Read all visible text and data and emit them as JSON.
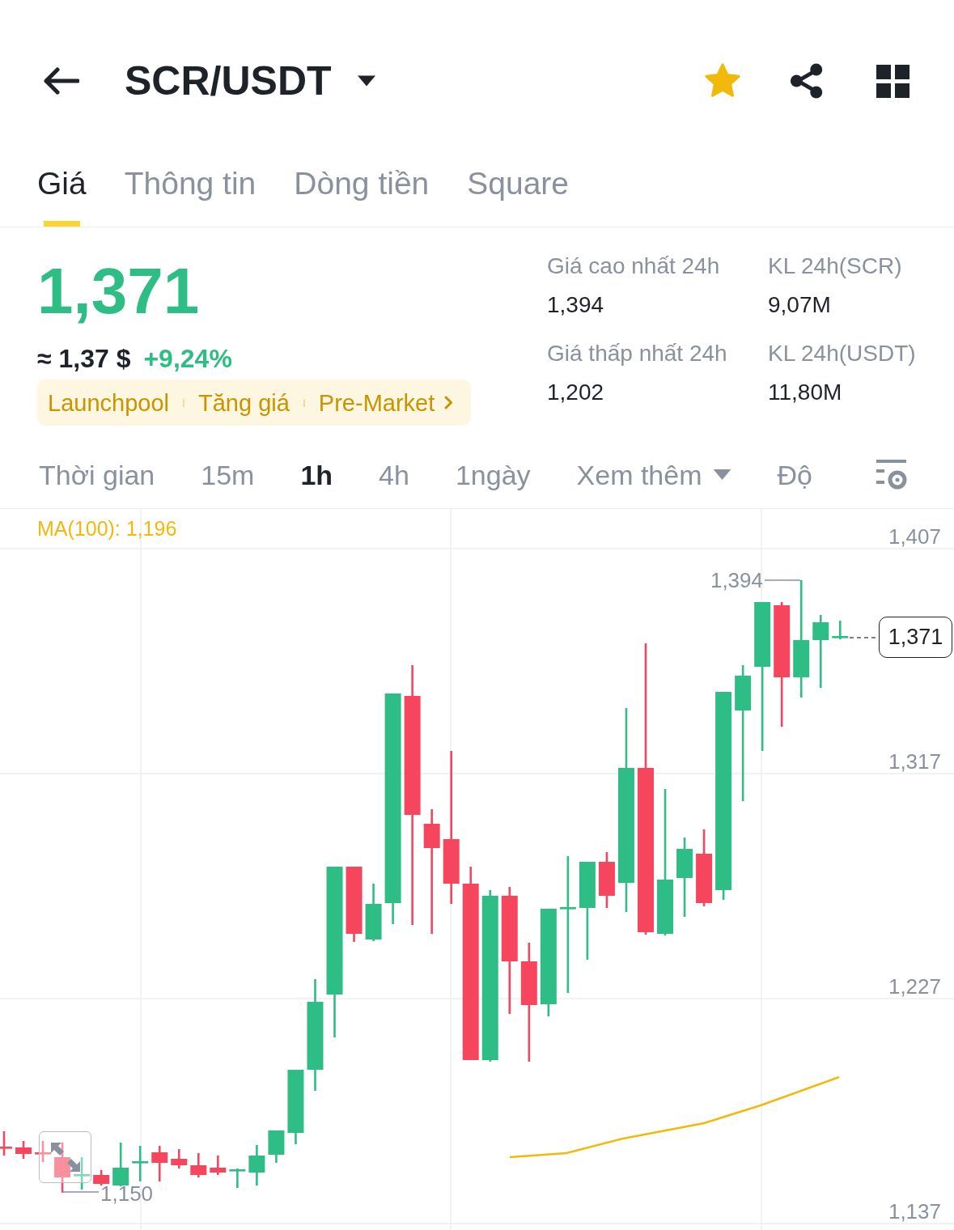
{
  "header": {
    "title": "SCR/USDT",
    "favorite": true
  },
  "tabs": [
    {
      "label": "Giá",
      "selected": true
    },
    {
      "label": "Thông tin",
      "selected": false
    },
    {
      "label": "Dòng tiền",
      "selected": false
    },
    {
      "label": "Square",
      "selected": false
    }
  ],
  "price": {
    "last": "1,371",
    "approx": "≈ 1,37 $",
    "change": "+9,24%"
  },
  "tags": [
    "Launchpool",
    "Tăng giá",
    "Pre-Market"
  ],
  "stats": [
    {
      "label": "Giá cao nhất 24h",
      "value": "1,394"
    },
    {
      "label": "KL 24h(SCR)",
      "value": "9,07M"
    },
    {
      "label": "Giá thấp nhất 24h",
      "value": "1,202"
    },
    {
      "label": "KL 24h(USDT)",
      "value": "11,80M"
    }
  ],
  "intervals": [
    {
      "label": "Thời gian",
      "kind": "tab",
      "selected": false
    },
    {
      "label": "15m",
      "kind": "tab",
      "selected": false
    },
    {
      "label": "1h",
      "kind": "tab",
      "selected": true
    },
    {
      "label": "4h",
      "kind": "tab",
      "selected": false
    },
    {
      "label": "1ngày",
      "kind": "tab",
      "selected": false
    },
    {
      "label": "Xem thêm",
      "kind": "dropdown",
      "selected": false
    },
    {
      "label": "Độ",
      "kind": "tab",
      "selected": false
    }
  ],
  "chart": {
    "indicator": "MA(100): 1,196",
    "axis_labels": [
      "1,407",
      "1,317",
      "1,227",
      "1,137"
    ],
    "high_label": "1,394",
    "low_label": "1,150",
    "last_price": "1,371"
  }
}
